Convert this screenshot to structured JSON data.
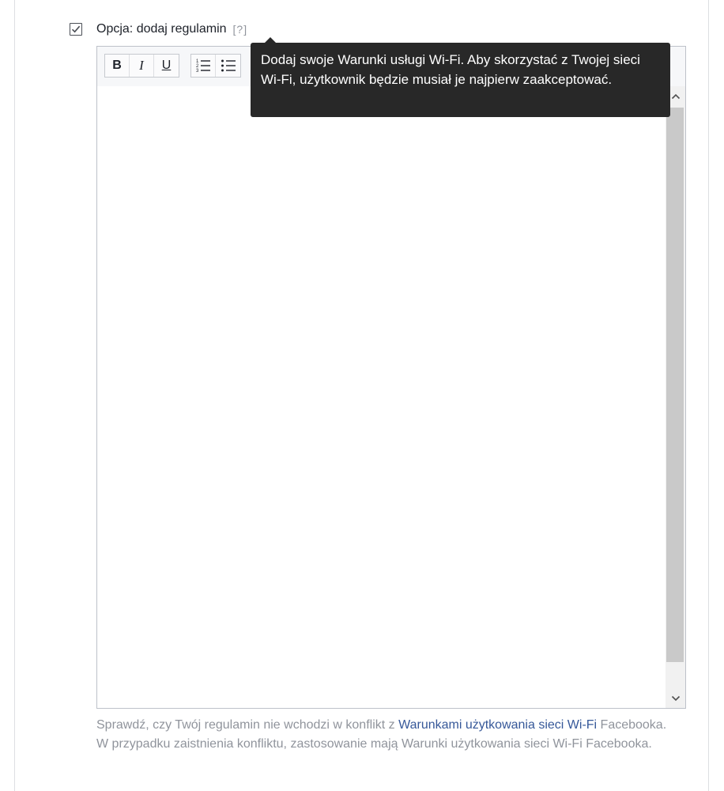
{
  "option": {
    "checked": true,
    "label": "Opcja: dodaj regulamin",
    "help": "[?]"
  },
  "toolbar": {
    "bold": "B",
    "italic": "I",
    "underline": "U"
  },
  "tooltip": {
    "text": "Dodaj swoje Warunki usługi Wi-Fi. Aby skorzystać z Twojej sieci Wi-Fi, użytkownik będzie musiał je najpierw zaakceptować."
  },
  "note": {
    "before_link": "Sprawdź, czy Twój regulamin nie wchodzi w konflikt z ",
    "link": "Warunkami użytkowania sieci Wi-Fi",
    "after_link": " Facebooka. W przypadku zaistnienia konfliktu, zastosowanie mają Warunki użytkowania sieci Wi-Fi Facebooka."
  },
  "colors": {
    "link": "#365899",
    "note_text": "#90949c",
    "tooltip_bg": "#282828"
  }
}
